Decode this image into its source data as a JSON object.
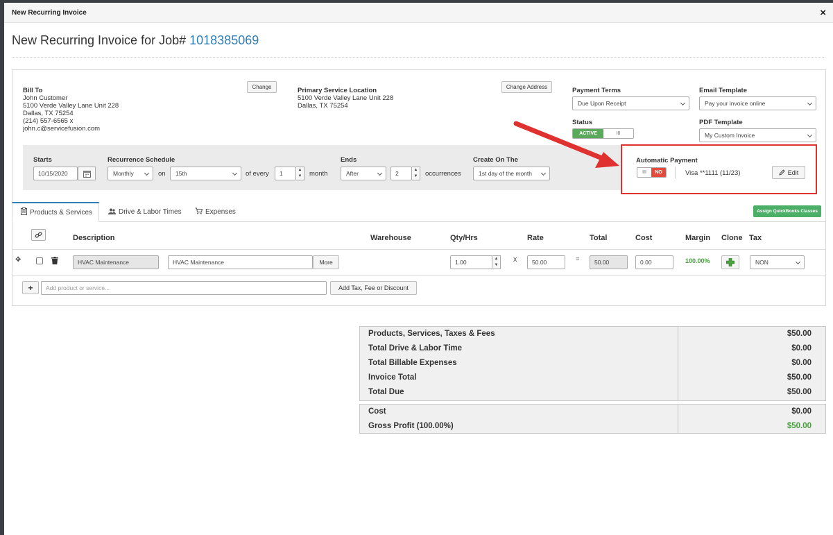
{
  "modal": {
    "title": "New Recurring Invoice",
    "close": "×"
  },
  "page": {
    "title_prefix": "New Recurring Invoice for Job#",
    "job_number": "1018385069"
  },
  "bill_to": {
    "label": "Bill To",
    "change_label": "Change",
    "lines": [
      "John Customer",
      "5100 Verde Valley Lane Unit 228",
      "Dallas, TX 75254",
      "(214) 557-6565 x",
      "john.c@servicefusion.com"
    ]
  },
  "service_location": {
    "label": "Primary Service Location",
    "change_label": "Change Address",
    "lines": [
      "5100 Verde Valley Lane Unit 228",
      "Dallas, TX 75254"
    ]
  },
  "payment_terms": {
    "label": "Payment Terms",
    "value": "Due Upon Receipt"
  },
  "email_template": {
    "label": "Email Template",
    "value": "Pay your invoice online"
  },
  "status": {
    "label": "Status",
    "on_label": "ACTIVE",
    "handle": "III"
  },
  "pdf_template": {
    "label": "PDF Template",
    "value": "My Custom Invoice"
  },
  "recurrence": {
    "starts_label": "Starts",
    "starts_value": "10/15/2020",
    "schedule_label": "Recurrence Schedule",
    "schedule_value": "Monthly",
    "on_label": "on",
    "day_value": "15th",
    "every_label": "of every",
    "every_value": "1",
    "month_label": "month",
    "ends_label": "Ends",
    "ends_value": "After",
    "occurrences_value": "2",
    "occurrences_label": "occurrences",
    "create_label": "Create On The",
    "create_value": "1st day of the month"
  },
  "auto_payment": {
    "label": "Automatic Payment",
    "handle": "III",
    "off_label": "NO",
    "card": "Visa **1111 (11/23)",
    "edit_label": "Edit"
  },
  "tabs": [
    {
      "label": "Products & Services",
      "icon": "clipboard-icon"
    },
    {
      "label": "Drive & Labor Times",
      "icon": "users-icon"
    },
    {
      "label": "Expenses",
      "icon": "cart-icon"
    }
  ],
  "quickbooks_button": "Assign QuickBooks Classes",
  "table": {
    "headers": {
      "description": "Description",
      "warehouse": "Warehouse",
      "qty": "Qty/Hrs",
      "rate": "Rate",
      "total": "Total",
      "cost": "Cost",
      "margin": "Margin",
      "clone": "Clone",
      "tax": "Tax"
    },
    "row": {
      "product": "HVAC Maintenance",
      "description": "HVAC Maintenance",
      "more": "More",
      "qty": "1.00",
      "x": "X",
      "rate": "50.00",
      "eq": "=",
      "total": "50.00",
      "cost": "0.00",
      "margin": "100.00%",
      "tax": "NON"
    }
  },
  "add_row": {
    "plus": "+",
    "placeholder": "Add product or service...",
    "tax_button": "Add Tax, Fee or Discount"
  },
  "totals": [
    {
      "label": "Products, Services, Taxes & Fees",
      "value": "$50.00"
    },
    {
      "label": "Total Drive & Labor Time",
      "value": "$0.00"
    },
    {
      "label": "Total Billable Expenses",
      "value": "$0.00"
    },
    {
      "label": "Invoice Total",
      "value": "$50.00"
    },
    {
      "label": "Total Due",
      "value": "$50.00"
    }
  ],
  "profit": [
    {
      "label": "Cost",
      "value": "$0.00"
    },
    {
      "label": "Gross Profit (100.00%)",
      "value": "$50.00"
    }
  ],
  "colors": {
    "accent": "#2d7fb8",
    "active": "#5aaa5b",
    "off": "#e44b3c",
    "highlight": "#e03131",
    "margin": "#4a9c3f"
  }
}
